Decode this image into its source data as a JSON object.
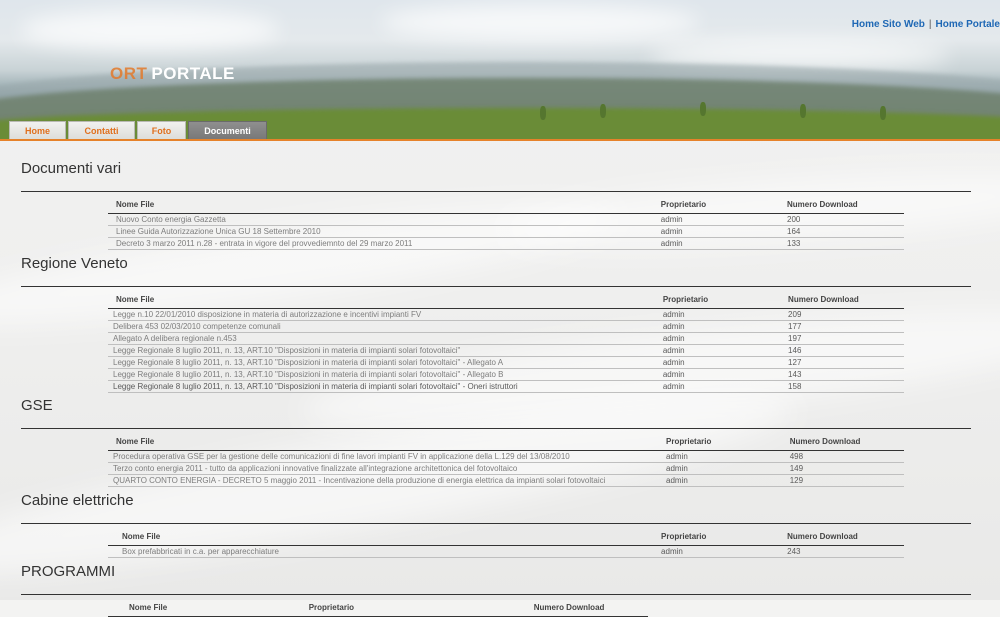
{
  "header": {
    "logo_part1": "ORT",
    "logo_part2": "PORTALE",
    "links": [
      "Home Sito Web",
      "Home Portale"
    ],
    "separator": "|"
  },
  "tabs": [
    {
      "label": "Home",
      "active": false
    },
    {
      "label": "Contatti",
      "active": false
    },
    {
      "label": "Foto",
      "active": false
    },
    {
      "label": "Documenti",
      "active": true
    }
  ],
  "columns": {
    "name": "Nome File",
    "owner": "Proprietario",
    "downloads": "Numero Download"
  },
  "sections": [
    {
      "title": "Documenti vari",
      "rows": [
        {
          "name": "Nuovo Conto energia Gazzetta",
          "owner": "admin",
          "downloads": "200"
        },
        {
          "name": "Linee Guida Autorizzazione Unica GU 18 Settembre 2010",
          "owner": "admin",
          "downloads": "164"
        },
        {
          "name": "Decreto 3 marzo 2011 n.28 - entrata in vigore del provvediemnto del 29 marzo 2011",
          "owner": "admin",
          "downloads": "133"
        }
      ]
    },
    {
      "title": "Regione Veneto",
      "rows": [
        {
          "name": "Legge n.10 22/01/2010 disposizione in materia di autorizzazione e incentivi impianti FV",
          "owner": "admin",
          "downloads": "209"
        },
        {
          "name": "Delibera 453 02/03/2010 competenze comunali",
          "owner": "admin",
          "downloads": "177"
        },
        {
          "name": "Allegato A delibera regionale n.453",
          "owner": "admin",
          "downloads": "197"
        },
        {
          "name": "Legge Regionale 8 luglio 2011, n. 13, ART.10 \"Disposizioni in materia di impianti solari fotovoltaici\"",
          "owner": "admin",
          "downloads": "146"
        },
        {
          "name": "Legge Regionale 8 luglio 2011, n. 13, ART.10 \"Disposizioni in materia di impianti solari fotovoltaici\" - Allegato A",
          "owner": "admin",
          "downloads": "127"
        },
        {
          "name": "Legge Regionale 8 luglio 2011, n. 13, ART.10 \"Disposizioni in materia di impianti solari fotovoltaici\" - Allegato B",
          "owner": "admin",
          "downloads": "143"
        },
        {
          "name": "Legge Regionale 8 luglio 2011, n. 13, ART.10 \"Disposizioni in materia di impianti solari fotovoltaici\" - Oneri istruttori",
          "owner": "admin",
          "downloads": "158"
        }
      ]
    },
    {
      "title": "GSE",
      "rows": [
        {
          "name": "Procedura operativa GSE per la gestione delle comunicazioni di fine lavori impianti FV in applicazione della L.129 del 13/08/2010",
          "owner": "admin",
          "downloads": "498"
        },
        {
          "name": "Terzo conto energia 2011 - tutto da applicazioni innovative finalizzate all'integrazione architettonica del fotovoltaico",
          "owner": "admin",
          "downloads": "149"
        },
        {
          "name": "QUARTO CONTO ENERGIA - DECRETO 5 maggio 2011 - Incentivazione della produzione di energia elettrica da impianti solari fotovoltaici",
          "owner": "admin",
          "downloads": "129"
        }
      ]
    },
    {
      "title": "Cabine elettriche",
      "rows": [
        {
          "name": "Box prefabbricati in c.a. per apparecchiature",
          "owner": "admin",
          "downloads": "243"
        }
      ]
    },
    {
      "title": "PROGRAMMI",
      "rows": []
    }
  ]
}
